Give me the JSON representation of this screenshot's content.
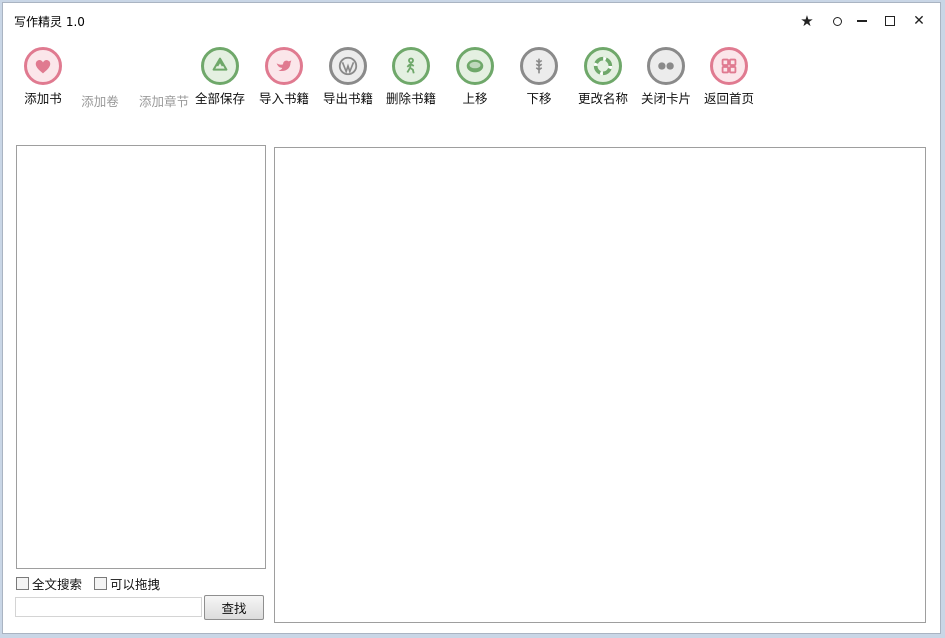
{
  "window": {
    "title": "写作精灵 1.0"
  },
  "toolbar": {
    "items": [
      {
        "label": "添加书",
        "icon": "heart-icon",
        "color": "#e07a90",
        "enabled": true
      },
      {
        "label": "添加卷",
        "icon": "",
        "color": "",
        "enabled": false
      },
      {
        "label": "添加章节",
        "icon": "",
        "color": "",
        "enabled": false
      },
      {
        "label": "全部保存",
        "icon": "recycle-icon",
        "color": "#6fa86a",
        "enabled": true
      },
      {
        "label": "导入书籍",
        "icon": "twitter-bird-icon",
        "color": "#e07a90",
        "enabled": true
      },
      {
        "label": "导出书籍",
        "icon": "wordpress-icon",
        "color": "#8a8a8a",
        "enabled": true
      },
      {
        "label": "删除书籍",
        "icon": "walker-icon",
        "color": "#6fa86a",
        "enabled": true
      },
      {
        "label": "上移",
        "icon": "disc-icon",
        "color": "#6fa86a",
        "enabled": true
      },
      {
        "label": "下移",
        "icon": "wheat-icon",
        "color": "#8a8a8a",
        "enabled": true
      },
      {
        "label": "更改名称",
        "icon": "lifebuoy-icon",
        "color": "#6fa86a",
        "enabled": true
      },
      {
        "label": "关闭卡片",
        "icon": "flickr-icon",
        "color": "#8a8a8a",
        "enabled": true
      },
      {
        "label": "返回首页",
        "icon": "grid-icon",
        "color": "#e07a90",
        "enabled": true
      }
    ]
  },
  "search": {
    "fulltext_label": "全文搜索",
    "draggable_label": "可以拖拽",
    "input_value": "",
    "button_label": "查找"
  }
}
